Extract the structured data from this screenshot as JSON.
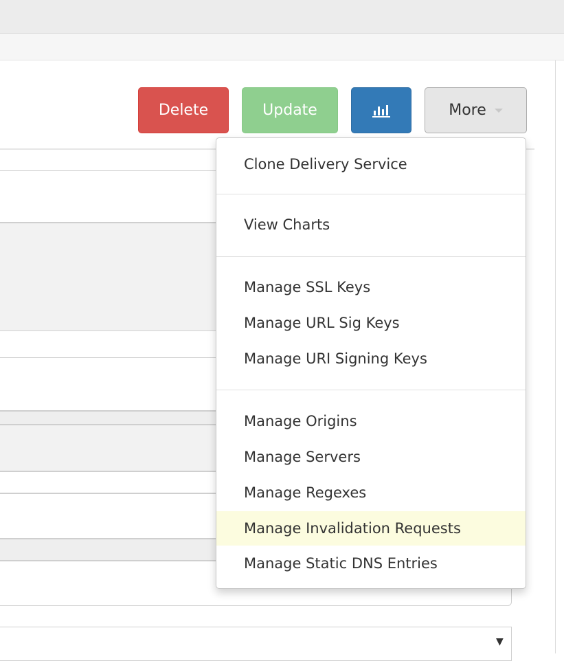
{
  "toolbar": {
    "delete_label": "Delete",
    "update_label": "Update",
    "chart_icon": "bar-chart-icon",
    "more_label": "More"
  },
  "colors": {
    "delete": "#d9534f",
    "update": "#8fcf8f",
    "chart": "#337ab7",
    "more": "#e6e6e6",
    "highlight": "#fcfcdf"
  },
  "more_menu": {
    "groups": [
      [
        "Clone Delivery Service"
      ],
      [
        "View Charts"
      ],
      [
        "Manage SSL Keys",
        "Manage URL Sig Keys",
        "Manage URI Signing Keys"
      ],
      [
        "Manage Origins",
        "Manage Servers",
        "Manage Regexes",
        "Manage Invalidation Requests",
        "Manage Static DNS Entries"
      ]
    ],
    "highlighted_item": "Manage Invalidation Requests"
  }
}
